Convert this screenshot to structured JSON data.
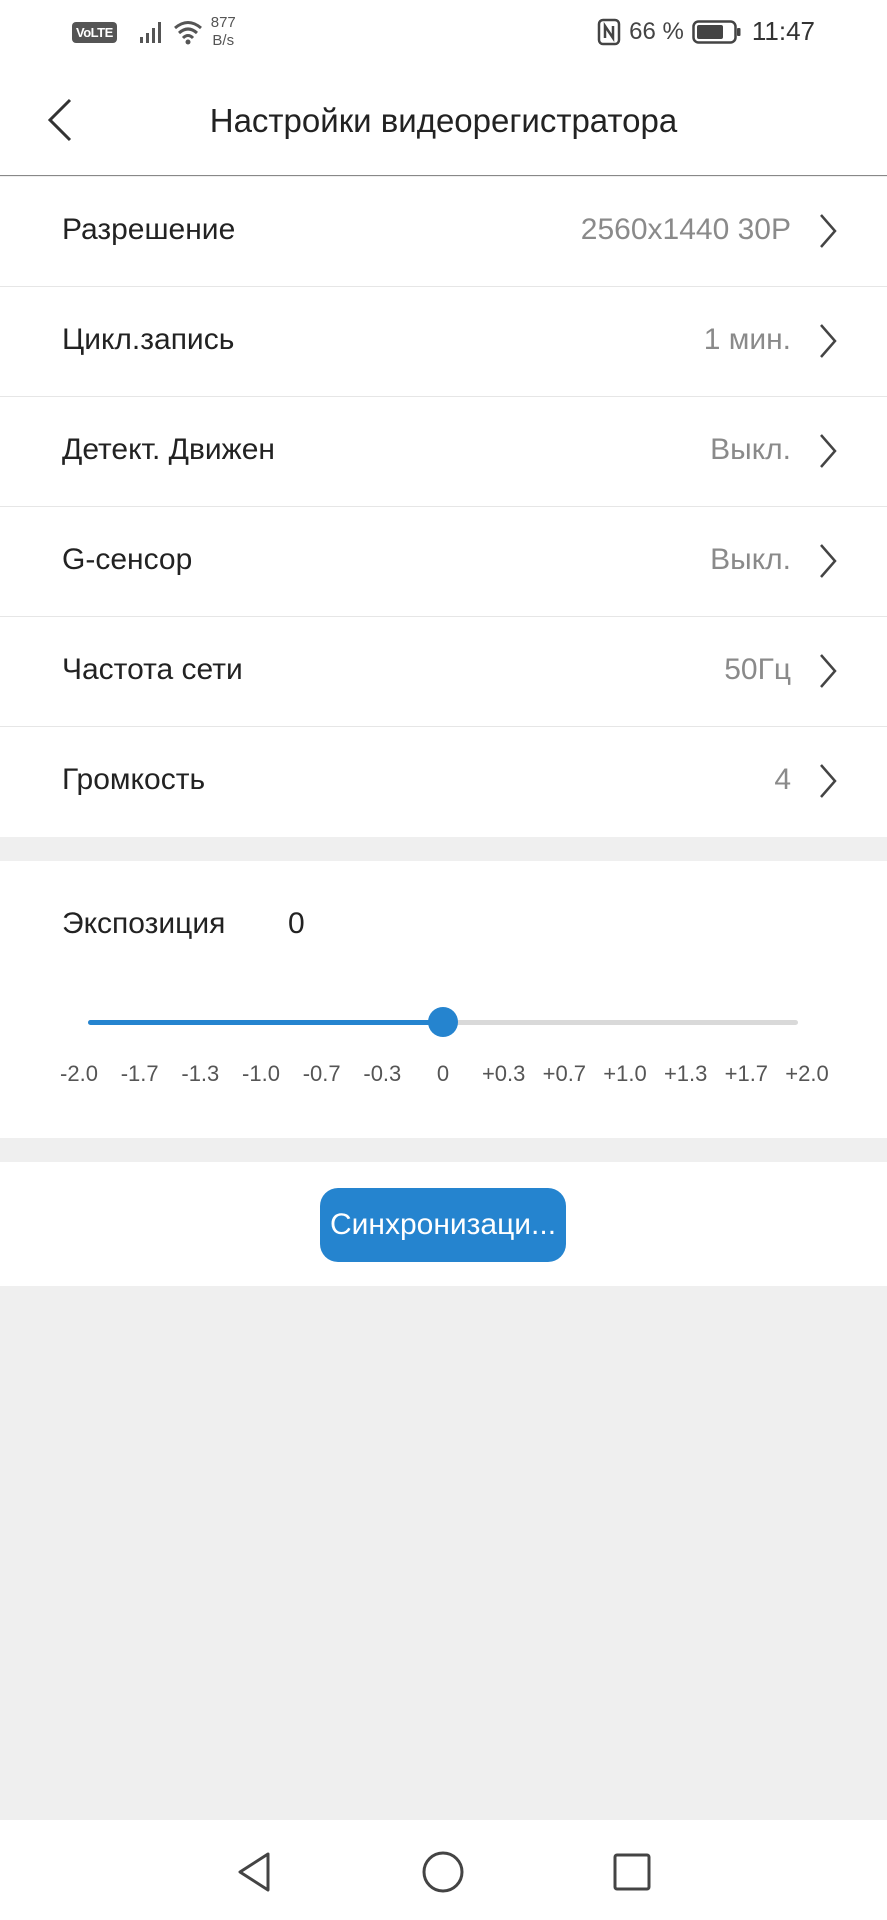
{
  "status_bar": {
    "volte": "VoLTE",
    "net_speed_value": "877",
    "net_speed_unit": "B/s",
    "battery": "66 %",
    "time": "11:47"
  },
  "header": {
    "title": "Настройки видеорегистратора",
    "back_icon": "chevron-left-icon"
  },
  "settings": [
    {
      "label": "Разрешение",
      "value": "2560x1440 30P"
    },
    {
      "label": "Цикл.запись",
      "value": "1 мин."
    },
    {
      "label": "Детект. Движен",
      "value": "Выкл."
    },
    {
      "label": "G-сенсор",
      "value": "Выкл."
    },
    {
      "label": "Частота сети",
      "value": "50Гц"
    },
    {
      "label": "Громкость",
      "value": "4"
    }
  ],
  "exposure": {
    "label": "Экспозиция",
    "value": "0",
    "current": 0,
    "min": -2.0,
    "max": 2.0,
    "ticks": [
      "-2.0",
      "-1.7",
      "-1.3",
      "-1.0",
      "-0.7",
      "-0.3",
      "0",
      "+0.3",
      "+0.7",
      "+1.0",
      "+1.3",
      "+1.7",
      "+2.0"
    ]
  },
  "sync": {
    "label": "Синхронизаци..."
  },
  "colors": {
    "accent": "#2584cf",
    "background": "#efefef"
  }
}
